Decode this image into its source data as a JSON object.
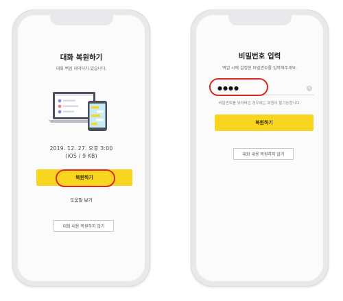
{
  "left_phone": {
    "title": "대화 복원하기",
    "subtitle": "대화 백업 데이터가 있습니다.",
    "backup_date": "2019. 12. 27. 오후 3:00",
    "backup_info": "(iOS / 9 KB)",
    "restore_button": "복원하기",
    "help_link": "도움말 보기",
    "skip_button": "대화 내용 복원하지 않기"
  },
  "right_phone": {
    "title": "비밀번호 입력",
    "subtitle": "백업 시에 설정한 비밀번호를 입력해주세요.",
    "password_value": "●●●●",
    "clear_icon": "×",
    "hint": "비밀번호를 잊어버린 경우에는 복원이 불가능합니다.",
    "restore_button": "복원하기",
    "skip_button": "대화 내용 복원하지 않기"
  },
  "colors": {
    "accent_yellow": "#f8d51e",
    "highlight_red": "#e0261c"
  }
}
